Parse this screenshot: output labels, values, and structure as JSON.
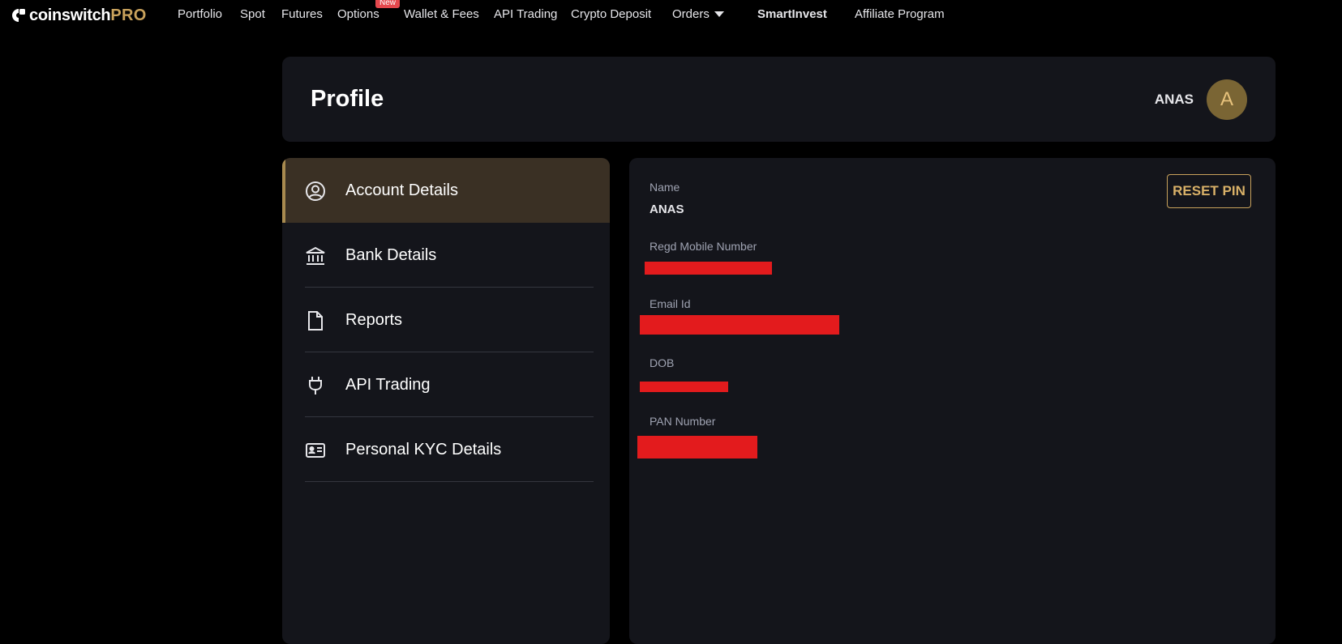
{
  "brand": {
    "name": "coinswitch",
    "suffix": "PRO"
  },
  "nav": {
    "portfolio": "Portfolio",
    "spot": "Spot",
    "futures": "Futures",
    "options": "Options",
    "options_badge": "New",
    "wallet": "Wallet & Fees",
    "api_trading": "API Trading",
    "crypto_deposit": "Crypto Deposit",
    "orders": "Orders",
    "smartinvest": "SmartInvest",
    "affiliate": "Affiliate Program"
  },
  "profile": {
    "title": "Profile",
    "username": "ANAS",
    "avatar_letter": "A"
  },
  "menu": {
    "items": [
      {
        "label": "Account Details",
        "icon": "user-circle-icon",
        "active": true
      },
      {
        "label": "Bank Details",
        "icon": "bank-icon",
        "active": false
      },
      {
        "label": "Reports",
        "icon": "document-icon",
        "active": false
      },
      {
        "label": "API Trading",
        "icon": "plug-icon",
        "active": false
      },
      {
        "label": "Personal KYC Details",
        "icon": "id-card-icon",
        "active": false
      }
    ]
  },
  "account": {
    "name_label": "Name",
    "name_value": "ANAS",
    "mobile_label": "Regd Mobile Number",
    "email_label": "Email Id",
    "dob_label": "DOB",
    "pan_label": "PAN Number",
    "reset_pin": "RESET PIN"
  },
  "colors": {
    "background": "#000000",
    "card": "#14151b",
    "accent_gold": "#c9a25c",
    "active_item": "#3a3024",
    "redaction": "#e31b1d",
    "badge_new": "#e5484d"
  }
}
